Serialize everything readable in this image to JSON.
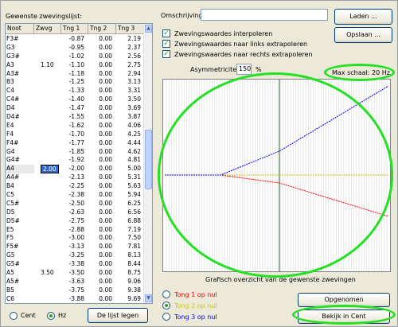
{
  "left": {
    "title": "Gewenste zwevingslijst:",
    "headers": [
      "Noot",
      "Zwvg",
      "Tng 1",
      "Tng 2",
      "Tng 3"
    ],
    "rows": [
      [
        "F3#",
        "",
        "-0.87",
        "0.00",
        "2.19"
      ],
      [
        "G3",
        "",
        "-0.95",
        "0.00",
        "2.37"
      ],
      [
        "G3#",
        "",
        "-1.02",
        "0.00",
        "2.56"
      ],
      [
        "A3",
        "1.10",
        "-1.10",
        "0.00",
        "2.75"
      ],
      [
        "A3#",
        "",
        "-1.18",
        "0.00",
        "2.94"
      ],
      [
        "B3",
        "",
        "-1.25",
        "0.00",
        "3.13"
      ],
      [
        "C4",
        "",
        "-1.33",
        "0.00",
        "3.31"
      ],
      [
        "C4#",
        "",
        "-1.40",
        "0.00",
        "3.50"
      ],
      [
        "D4",
        "",
        "-1.47",
        "0.00",
        "3.69"
      ],
      [
        "D4#",
        "",
        "-1.55",
        "0.00",
        "3.87"
      ],
      [
        "E4",
        "",
        "-1.62",
        "0.00",
        "4.06"
      ],
      [
        "F4",
        "",
        "-1.70",
        "0.00",
        "4.25"
      ],
      [
        "F4#",
        "",
        "-1.77",
        "0.00",
        "4.44"
      ],
      [
        "G4",
        "",
        "-1.85",
        "0.00",
        "4.62"
      ],
      [
        "G4#",
        "",
        "-1.92",
        "0.00",
        "4.81"
      ],
      [
        "A4",
        "2.00",
        "-2.00",
        "0.00",
        "5.00"
      ],
      [
        "A4#",
        "",
        "-2.13",
        "0.00",
        "5.31"
      ],
      [
        "B4",
        "",
        "-2.25",
        "0.00",
        "5.63"
      ],
      [
        "C5",
        "",
        "-2.38",
        "0.00",
        "5.94"
      ],
      [
        "C5#",
        "",
        "-2.50",
        "0.00",
        "6.25"
      ],
      [
        "D5",
        "",
        "-2.63",
        "0.00",
        "6.56"
      ],
      [
        "D5#",
        "",
        "-2.75",
        "0.00",
        "6.88"
      ],
      [
        "E5",
        "",
        "-2.88",
        "0.00",
        "7.19"
      ],
      [
        "F5",
        "",
        "-3.00",
        "0.00",
        "7.50"
      ],
      [
        "F5#",
        "",
        "-3.13",
        "0.00",
        "7.81"
      ],
      [
        "G5",
        "",
        "-3.25",
        "0.00",
        "8.13"
      ],
      [
        "G5#",
        "",
        "-3.38",
        "0.00",
        "8.44"
      ],
      [
        "A5",
        "3.50",
        "-3.50",
        "0.00",
        "8.75"
      ],
      [
        "A5#",
        "",
        "-3.63",
        "0.00",
        "9.06"
      ],
      [
        "B5",
        "",
        "-3.75",
        "0.00",
        "9.38"
      ],
      [
        "C6",
        "",
        "-3.88",
        "0.00",
        "9.69"
      ],
      [
        "C6#",
        "",
        "-4.00",
        "0.00",
        "10.00"
      ]
    ],
    "selected_row": 15,
    "radio_cent": "Cent",
    "radio_hz": "Hz",
    "hz_selected": true,
    "clear_button": "De lijst legen"
  },
  "right": {
    "omschrijving_label": "Omschrijving:",
    "omschrijving_value": "",
    "load_button": "Laden ...",
    "save_button": "Opslaan ...",
    "chk_interpolate": "Zwevingswaardes interpoleren",
    "chk_left": "Zwevingswaardes naar links extrapoleren",
    "chk_right": "Zwevingswaardes naar rechts extrapoleren",
    "asym_label": "Asymmetriciteit",
    "asym_value": "150",
    "asym_unit": "%",
    "max_scale": "Max schaal: 20 Hz",
    "graph_caption": "Grafisch overzicht van de gewenste zwevingen",
    "radio_tng1": "Tong 1 op nul",
    "radio_tng2": "Tong 2 op nul",
    "radio_tng3": "Tong 3 op nul",
    "selected_tong": 2,
    "record_button": "Opgenomen",
    "view_cent_button": "Bekijk in Cent",
    "colors": {
      "tng1": "#ff0000",
      "tng2": "#c8c800",
      "tng3": "#0000ff",
      "highlight": "#23e023"
    }
  }
}
